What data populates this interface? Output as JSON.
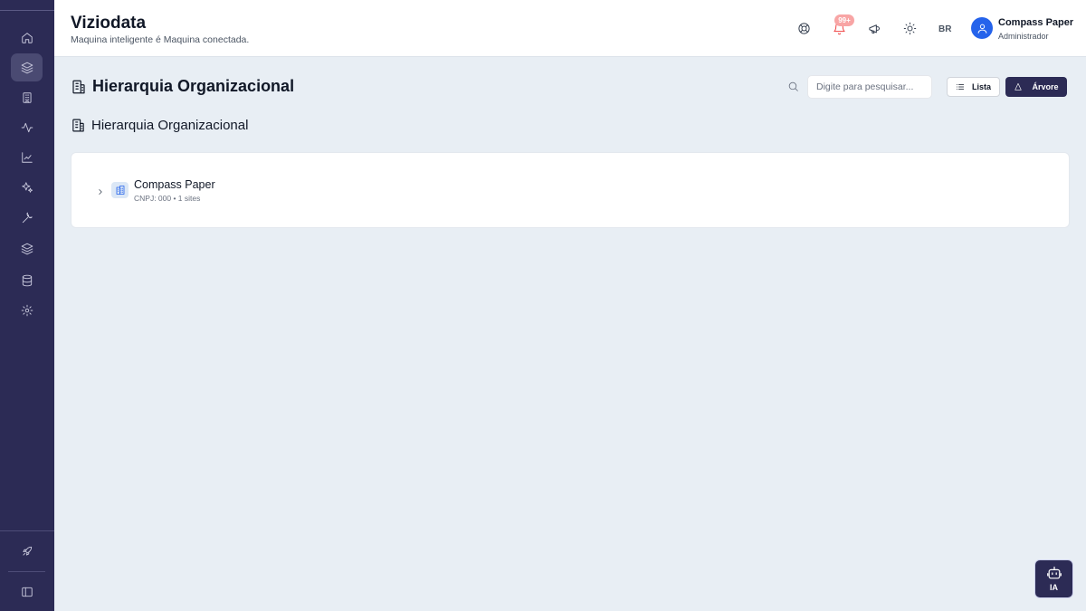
{
  "header": {
    "title": "Viziodata",
    "subtitle": "Maquina inteligente é Maquina conectada.",
    "notification_badge": "99+",
    "language": "BR",
    "user_name": "Compass Paper",
    "user_role": "Administrador"
  },
  "sidebar": {
    "items": [
      {
        "icon": "home-icon"
      },
      {
        "icon": "layers-icon",
        "active": true
      },
      {
        "icon": "building-icon"
      },
      {
        "icon": "activity-icon"
      },
      {
        "icon": "chart-line-icon"
      },
      {
        "icon": "sparkles-icon"
      },
      {
        "icon": "wrench-icon"
      },
      {
        "icon": "layers-icon"
      },
      {
        "icon": "database-icon"
      },
      {
        "icon": "gear-icon"
      }
    ],
    "bottom_items": [
      {
        "icon": "rocket-icon"
      },
      {
        "icon": "sidebar-toggle-icon"
      }
    ]
  },
  "page": {
    "title": "Hierarquia Organizacional",
    "search_placeholder": "Digite para pesquisar...",
    "view_list_label": "Lista",
    "view_tree_label": "Árvore",
    "active_view": "tree",
    "section_title": "Hierarquia Organizacional"
  },
  "tree": {
    "items": [
      {
        "name": "Compass Paper",
        "meta": "CNPJ: 000 • 1 sites",
        "expanded": false
      }
    ]
  },
  "assistant": {
    "label": "IA"
  },
  "colors": {
    "sidebar_bg": "#2c2b55",
    "page_bg": "#e8eef4",
    "accent_blue": "#2563eb",
    "alert_red": "#ef4444"
  }
}
